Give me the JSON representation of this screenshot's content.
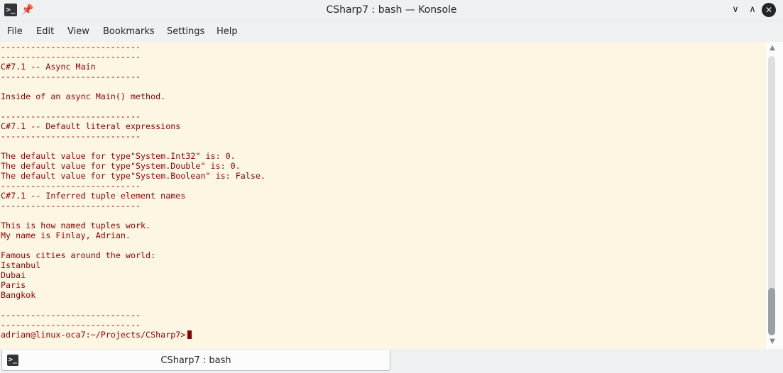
{
  "window": {
    "title": "CSharp7 : bash — Konsole",
    "app_icon": "terminal-icon",
    "pin_icon": "pin-icon",
    "min_glyph": "∨",
    "max_glyph": "∧",
    "close_glyph": "✕"
  },
  "menu": [
    "File",
    "Edit",
    "View",
    "Bookmarks",
    "Settings",
    "Help"
  ],
  "terminal": {
    "lines": [
      "----------------------------",
      "----------------------------",
      "C#7.1 -- Async Main",
      "----------------------------",
      "",
      "Inside of an async Main() method.",
      "",
      "----------------------------",
      "C#7.1 -- Default literal expressions",
      "----------------------------",
      "",
      "The default value for type\"System.Int32\" is: 0.",
      "The default value for type\"System.Double\" is: 0.",
      "The default value for type\"System.Boolean\" is: False.",
      "----------------------------",
      "C#7.1 -- Inferred tuple element names",
      "----------------------------",
      "",
      "This is how named tuples work.",
      "My name is Finlay, Adrian.",
      "",
      "Famous cities around the world:",
      "Istanbul",
      "Dubai",
      "Paris",
      "Bangkok",
      "",
      "----------------------------",
      "----------------------------"
    ],
    "prompt": "adrian@linux-oca7:~/Projects/CSharp7> ",
    "text_color": "#8b0000",
    "background_color": "#fdf6e3"
  },
  "scrollbar": {
    "up_glyph": "▲",
    "down_glyph": "▼",
    "position_fraction": 0.95
  },
  "tabs": [
    {
      "label": "CSharp7 : bash",
      "icon": "terminal-icon"
    }
  ]
}
